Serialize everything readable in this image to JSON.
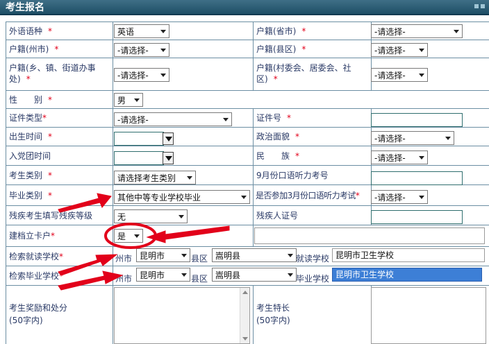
{
  "header": {
    "title": "考生报名"
  },
  "placeholder_select": "-请选择-",
  "rows": {
    "foreign_language": {
      "label": "外语语种",
      "value": "英语"
    },
    "province": {
      "label": "户籍(省市)"
    },
    "city": {
      "label": "户籍(州市)"
    },
    "county": {
      "label": "户籍(县区)"
    },
    "town": {
      "label": "户籍(乡、镇、街道办事处)"
    },
    "village": {
      "label": "户籍(村委会、居委会、社区)"
    },
    "gender": {
      "label": "性　　别",
      "value": "男"
    },
    "id_type": {
      "label": "证件类型"
    },
    "id_number": {
      "label": "证件号"
    },
    "birth": {
      "label": "出生时间"
    },
    "political": {
      "label": "政治面貌"
    },
    "party_date": {
      "label": "入党团时间"
    },
    "ethnicity": {
      "label": "民　　族"
    },
    "category": {
      "label": "考生类别",
      "value": "请选择考生类别"
    },
    "listening_no": {
      "label": "9月份口语听力考号"
    },
    "grad_type": {
      "label": "毕业类别",
      "value": "其他中等专业学校毕业"
    },
    "march_listening": {
      "label": "是否参加3月份口语听力考试"
    },
    "disability_level": {
      "label": "残疾考生填写残疾等级",
      "value": "无"
    },
    "disability_cert": {
      "label": "残疾人证号"
    },
    "poverty_card": {
      "label": "建档立卡户",
      "value": "是"
    },
    "search_current_school": {
      "label": "检索就读学校",
      "city_label": "州市",
      "city_value": "昆明市",
      "county_label": "县区",
      "county_value": "嵩明县",
      "school_label": "就读学校",
      "school_value": "昆明市卫生学校"
    },
    "search_grad_school": {
      "label": "检索毕业学校",
      "city_label": "州市",
      "city_value": "昆明市",
      "county_label": "县区",
      "county_value": "嵩明县",
      "school_label": "毕业学校",
      "school_value": "昆明市卫生学校"
    },
    "awards": {
      "label": "考生奖励和处分",
      "note": "(50字内)"
    },
    "specialty": {
      "label": "考生特长",
      "note": "(50字内)"
    }
  },
  "required_mark": "*",
  "colors": {
    "header_bg": "#2b5c73",
    "border": "#6b8ea3",
    "required": "#e2001a",
    "annotation": "#e2001a",
    "highlight": "#3d7fd6"
  }
}
